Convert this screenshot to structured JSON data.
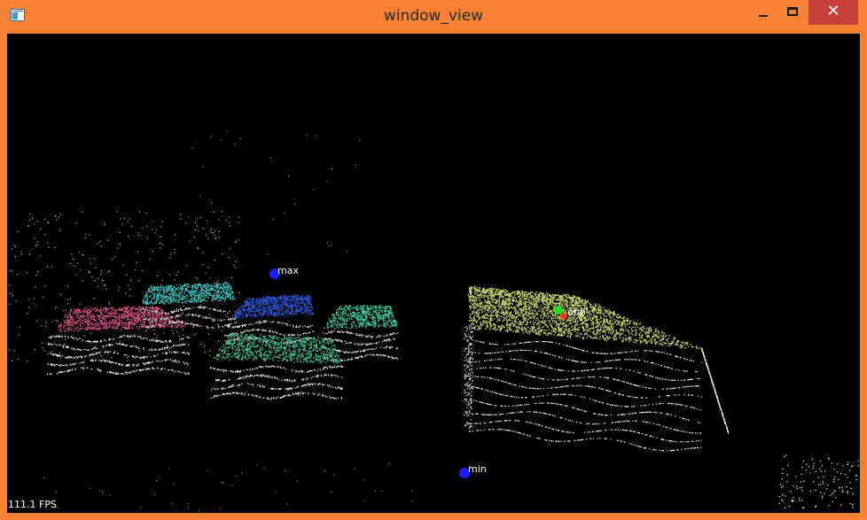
{
  "window": {
    "title": "window_view",
    "close_glyph": "✕",
    "accent_color": "#f58233",
    "close_color": "#c7403a"
  },
  "viewport": {
    "fps_text": "111.1 FPS",
    "markers": {
      "max_label": "max",
      "min_label": "min",
      "obj_label": "obb"
    },
    "colors": {
      "background": "#000000",
      "marker_blue": "#1b1bff",
      "marker_green": "#22dd22",
      "marker_red": "#e8401c",
      "cloud_pink": "#e0508c",
      "cloud_cyan": "#36c6c6",
      "cloud_blue": "#2a5ae0",
      "cloud_teal": "#3cd0a8",
      "cloud_green": "#3cc49a",
      "cloud_yellow": "#c8dc6a"
    }
  }
}
